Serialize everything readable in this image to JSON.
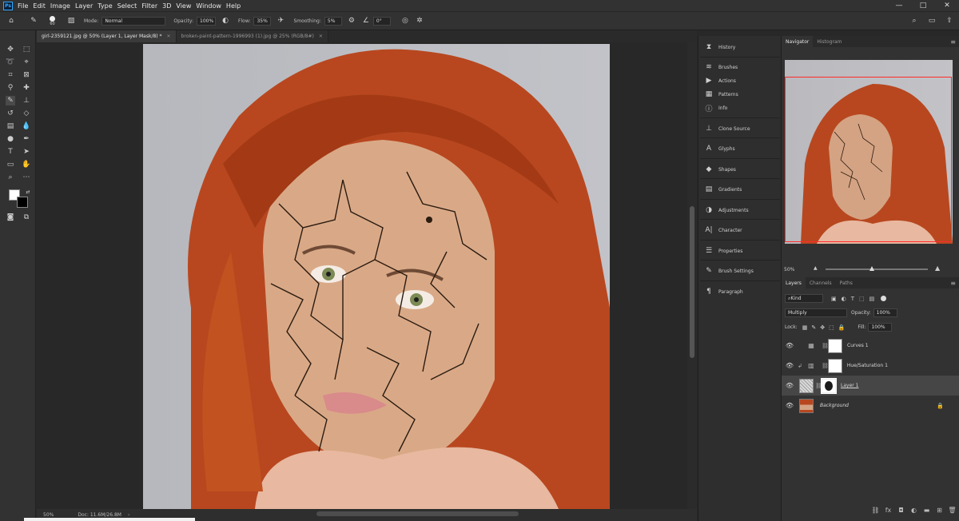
{
  "app": {
    "logo": "Ps"
  },
  "menu": [
    "File",
    "Edit",
    "Image",
    "Layer",
    "Type",
    "Select",
    "Filter",
    "3D",
    "View",
    "Window",
    "Help"
  ],
  "window_controls": [
    "—",
    "□",
    "✕"
  ],
  "options_bar": {
    "brush_size": "60",
    "mode_label": "Mode:",
    "mode_value": "Normal",
    "opacity_label": "Opacity:",
    "opacity_value": "100%",
    "flow_label": "Flow:",
    "flow_value": "35%",
    "smoothing_label": "Smoothing:",
    "smoothing_value": "5%",
    "angle_value": "0°"
  },
  "tabs": [
    {
      "label": "girl-2359121.jpg @ 50% (Layer 1, Layer Mask/8) *",
      "active": true
    },
    {
      "label": "broken-paint-pattern-1996993 (1).jpg @ 25% (RGB/8#)",
      "active": false
    }
  ],
  "status": {
    "zoom": "50%",
    "doc": "Doc: 11.6M/26.8M"
  },
  "dock": [
    {
      "label": "History",
      "icon": "history-icon"
    },
    {
      "label": "Brushes",
      "icon": "brushes-icon"
    },
    {
      "label": "Actions",
      "icon": "actions-icon"
    },
    {
      "label": "Patterns",
      "icon": "patterns-icon"
    },
    {
      "label": "Info",
      "icon": "info-icon"
    },
    {
      "label": "Clone Source",
      "icon": "clone-source-icon"
    },
    {
      "label": "Glyphs",
      "icon": "glyphs-icon"
    },
    {
      "label": "Shapes",
      "icon": "shapes-icon"
    },
    {
      "label": "Gradients",
      "icon": "gradients-icon"
    },
    {
      "label": "Adjustments",
      "icon": "adjustments-icon"
    },
    {
      "label": "Character",
      "icon": "character-icon"
    },
    {
      "label": "Properties",
      "icon": "properties-icon"
    },
    {
      "label": "Brush Settings",
      "icon": "brush-settings-icon"
    },
    {
      "label": "Paragraph",
      "icon": "paragraph-icon"
    }
  ],
  "navigator": {
    "tabs": [
      "Navigator",
      "Histogram"
    ],
    "zoom": "50%"
  },
  "layers_panel": {
    "tabs": [
      "Layers",
      "Channels",
      "Paths"
    ],
    "filter_kind": "Kind",
    "blend_mode": "Multiply",
    "opacity_label": "Opacity:",
    "opacity_value": "100%",
    "lock_label": "Lock:",
    "fill_label": "Fill:",
    "fill_value": "100%",
    "layers": [
      {
        "name": "Curves 1",
        "type": "adjustment",
        "selected": false
      },
      {
        "name": "Hue/Saturation 1",
        "type": "adjustment",
        "selected": false
      },
      {
        "name": "Layer 1",
        "type": "masked",
        "selected": true
      },
      {
        "name": "Background",
        "type": "background",
        "selected": false
      }
    ]
  },
  "colors": {
    "accent": "#31a8ff",
    "nav_frame": "#ff2b2b",
    "hair": "#b8471f",
    "skin": "#d9a987"
  }
}
